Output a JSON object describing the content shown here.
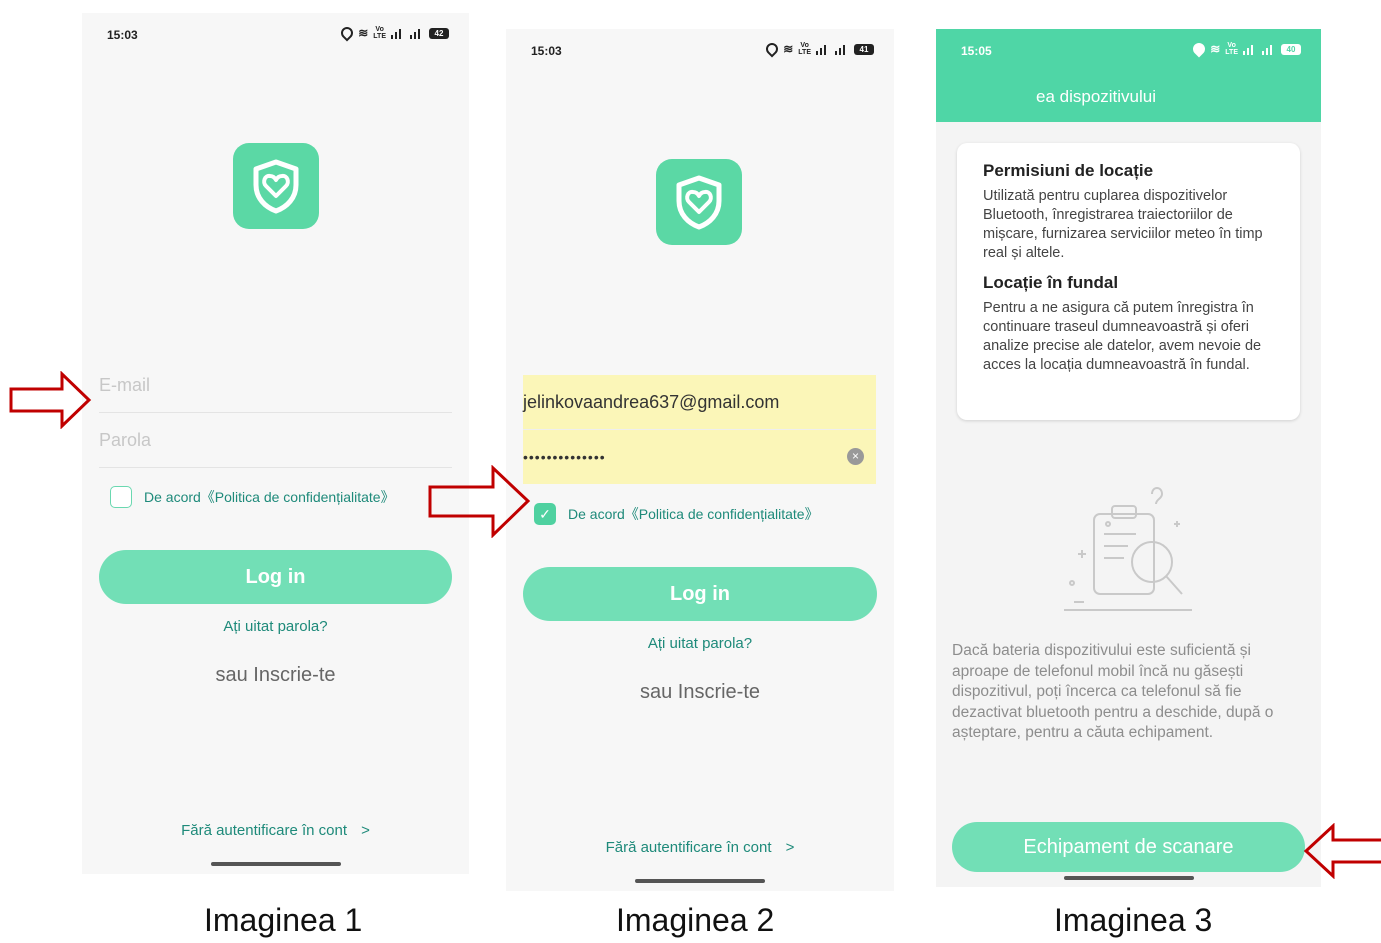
{
  "screen1": {
    "time": "15:03",
    "battery": "42",
    "email_placeholder": "E-mail",
    "password_placeholder": "Parola",
    "agree_text": "De acord《Politica de confidențialitate》",
    "agree_checked": false,
    "login_label": "Log in",
    "forgot_label": "Ați uitat parola?",
    "signup_label": "sau Inscrie-te",
    "noauth_label": "Fără autentificare în cont"
  },
  "screen2": {
    "time": "15:03",
    "battery": "41",
    "email_value": "jelinkovaandrea637@gmail.com",
    "password_value": "••••••••••••••",
    "agree_text": "De acord《Politica de confidențialitate》",
    "agree_checked": true,
    "login_label": "Log in",
    "forgot_label": "Ați uitat parola?",
    "signup_label": "sau Inscrie-te",
    "noauth_label": "Fără autentificare în cont"
  },
  "screen3": {
    "time": "15:05",
    "battery": "40",
    "title": "ea dispozitivului",
    "card": {
      "heading1": "Permisiuni de locație",
      "text1": "Utilizată pentru cuplarea dispozitivelor Bluetooth, înregistrarea traiectoriilor de mișcare, furnizarea serviciilor meteo în timp real și altele.",
      "heading2": "Locație în fundal",
      "text2": "Pentru a ne asigura că putem înregistra în continuare traseul dumneavoastră și oferi analize precise ale datelor, avem nevoie de acces la locația dumneavoastră în fundal."
    },
    "note": "Dacă bateria dispozitivului este suficientă și aproape de telefonul mobil încă nu găsești dispozitivul, poți încerca ca telefonul să fie dezactivat bluetooth pentru a deschide, după o așteptare, pentru a căuta echipament.",
    "scan_label": "Echipament de scanare"
  },
  "captions": [
    "Imaginea 1",
    "Imaginea 2",
    "Imaginea 3"
  ],
  "colors": {
    "accent": "#4fd6a6",
    "button": "#72dfb6",
    "link": "#1e8a7a",
    "arrow": "#c00000"
  }
}
